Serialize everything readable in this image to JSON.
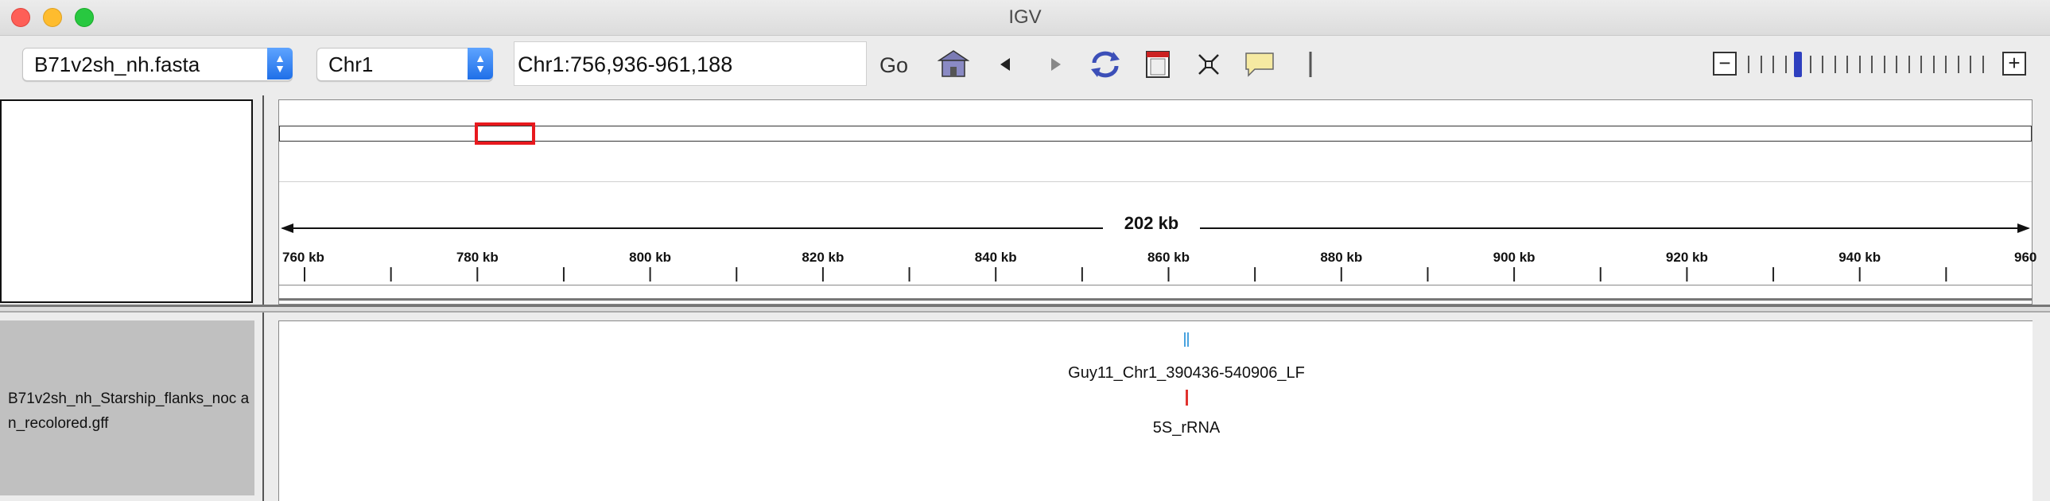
{
  "window": {
    "title": "IGV"
  },
  "toolbar": {
    "genome_select": "B71v2sh_nh.fasta",
    "chromosome_select": "Chr1",
    "locus_input": "Chr1:756,936-961,188",
    "go_label": "Go",
    "icons": [
      "home-icon",
      "back-icon",
      "forward-icon",
      "refresh-icon",
      "region-of-interest-icon",
      "resize-icon",
      "popup-info-icon",
      "ruler-icon"
    ]
  },
  "zoom": {
    "minus": "−",
    "plus": "+",
    "level_index": 4,
    "levels": 20
  },
  "ruler": {
    "span_label": "202 kb",
    "tick_labels": [
      "760 kb",
      "780 kb",
      "800 kb",
      "820 kb",
      "840 kb",
      "860 kb",
      "880 kb",
      "900 kb",
      "920 kb",
      "940 kb",
      "960"
    ]
  },
  "track": {
    "name": "B71v2sh_nh_Starship_flanks_noc an_recolored.gff",
    "features": [
      {
        "label": "Guy11_Chr1_390436-540906_LF",
        "color": "#4aa3df"
      },
      {
        "label": "5S_rRNA",
        "color": "#e0322e"
      }
    ]
  },
  "colors": {
    "roi_box": "#e8191e",
    "zoom_thumb": "#2e3fbf"
  }
}
